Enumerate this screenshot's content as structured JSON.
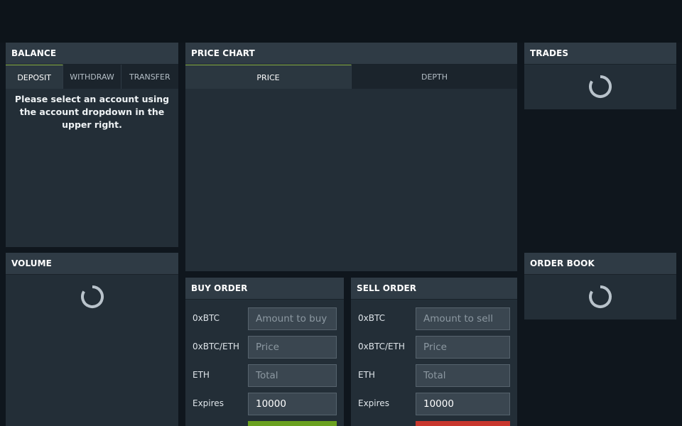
{
  "balance": {
    "title": "BALANCE",
    "tabs": [
      "DEPOSIT",
      "WITHDRAW",
      "TRANSFER"
    ],
    "message": "Please select an account using the account dropdown in the upper right."
  },
  "volume": {
    "title": "VOLUME"
  },
  "price_chart": {
    "title": "PRICE CHART",
    "tabs": [
      "PRICE",
      "DEPTH"
    ]
  },
  "trades": {
    "title": "TRADES"
  },
  "order_book": {
    "title": "ORDER BOOK"
  },
  "buy_order": {
    "title": "BUY ORDER",
    "rows": [
      {
        "label": "0xBTC",
        "placeholder": "Amount to buy",
        "value": ""
      },
      {
        "label": "0xBTC/ETH",
        "placeholder": "Price",
        "value": ""
      },
      {
        "label": "ETH",
        "placeholder": "Total",
        "value": ""
      },
      {
        "label": "Expires",
        "placeholder": "",
        "value": "10000"
      }
    ]
  },
  "sell_order": {
    "title": "SELL ORDER",
    "rows": [
      {
        "label": "0xBTC",
        "placeholder": "Amount to sell",
        "value": ""
      },
      {
        "label": "0xBTC/ETH",
        "placeholder": "Price",
        "value": ""
      },
      {
        "label": "ETH",
        "placeholder": "Total",
        "value": ""
      },
      {
        "label": "Expires",
        "placeholder": "",
        "value": "10000"
      }
    ]
  },
  "colors": {
    "background": "#0f161d",
    "panel": "#232e37",
    "header": "#2f3b45",
    "active_tab_accent": "#8fb64a",
    "buy": "#6aa11f",
    "sell": "#c8372d"
  },
  "icons": {
    "loading": "loading-spinner-icon"
  }
}
